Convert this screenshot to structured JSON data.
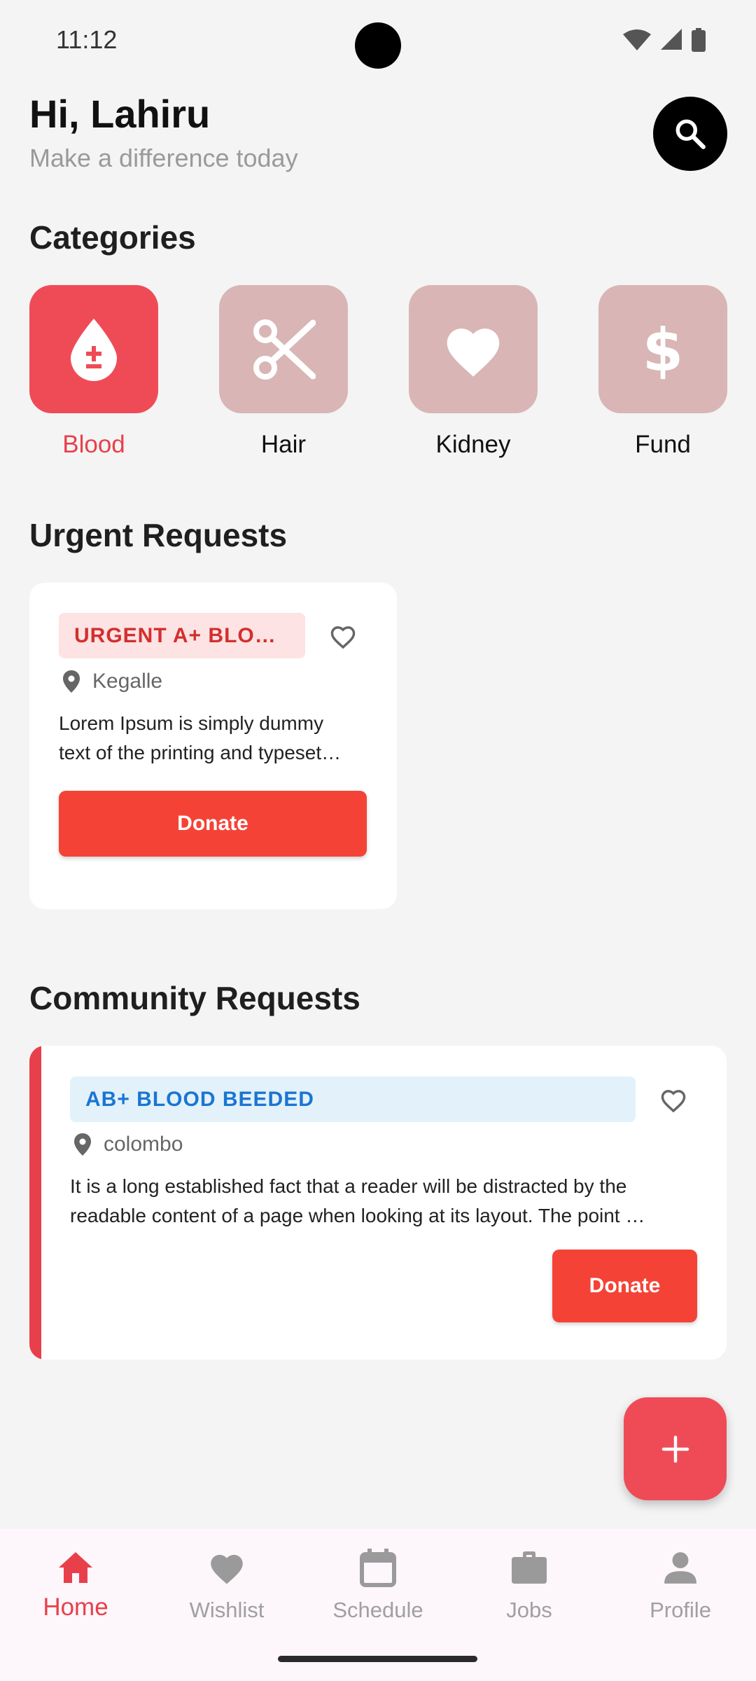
{
  "status_bar": {
    "time": "11:12",
    "icons": [
      "wifi-icon",
      "signal-icon",
      "battery-icon"
    ]
  },
  "header": {
    "greeting": "Hi, Lahiru",
    "subtitle": "Make a difference today",
    "search_icon": "search-icon"
  },
  "categories": {
    "title": "Categories",
    "items": [
      {
        "label": "Blood",
        "icon": "blood-drop-icon",
        "active": true
      },
      {
        "label": "Hair",
        "icon": "scissors-icon",
        "active": false
      },
      {
        "label": "Kidney",
        "icon": "heart-icon",
        "active": false
      },
      {
        "label": "Fund",
        "icon": "dollar-icon",
        "active": false
      }
    ]
  },
  "urgent": {
    "title": "Urgent Requests",
    "card": {
      "tag": "URGENT A+ BLOOD…",
      "location": "Kegalle",
      "description_lines": [
        "Lorem Ipsum is simply dummy",
        "text of the printing and typeset…"
      ],
      "button": "Donate"
    }
  },
  "community": {
    "title": "Community Requests",
    "card": {
      "tag": "AB+ BLOOD BEEDED",
      "location": "colombo",
      "description_lines": [
        "It is a long established fact that a reader will be distracted by the",
        "readable content of a page when looking at its layout. The point …"
      ],
      "button": "Donate"
    }
  },
  "fab": {
    "icon": "plus-icon"
  },
  "bottom_nav": {
    "items": [
      {
        "label": "Home",
        "icon": "home-icon",
        "active": true
      },
      {
        "label": "Wishlist",
        "icon": "heart-icon",
        "active": false
      },
      {
        "label": "Schedule",
        "icon": "calendar-icon",
        "active": false
      },
      {
        "label": "Jobs",
        "icon": "briefcase-icon",
        "active": false
      },
      {
        "label": "Profile",
        "icon": "person-icon",
        "active": false
      }
    ]
  },
  "colors": {
    "accent": "#ef4b57",
    "donate": "#f44336",
    "category_inactive": "#d9b5b5",
    "tag_red_bg": "#fde3e3",
    "tag_blue_bg": "#e3f1fb"
  }
}
